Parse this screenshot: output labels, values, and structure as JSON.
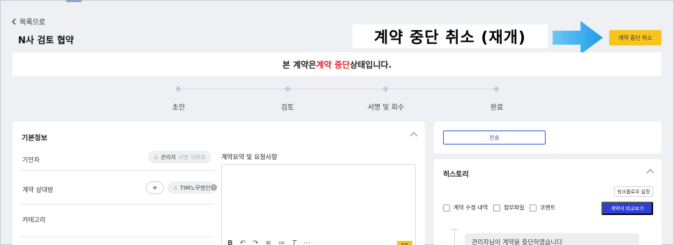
{
  "header": {
    "back_label": "목록으로",
    "title": "N사 검토 협약",
    "overlay_label": "계약 중단 취소 (재개)",
    "cancel_stop_button": "계약 중단 취소"
  },
  "banner": {
    "prefix": "본 계약은 ",
    "highlight": "계약 중단",
    "suffix": " 상태입니다."
  },
  "steps": [
    "초안",
    "검토",
    "서명 및 회수",
    "완료"
  ],
  "basic_info": {
    "title": "기본정보",
    "rows": {
      "requester_label": "기안자",
      "counterparty_label": "계약 상대방",
      "category_label": "카테고리"
    },
    "requester_pill": {
      "name": "관리자",
      "status": "서명 미완료"
    },
    "plus_label": "+",
    "counterparty_pill": "TIM노무법인",
    "remove_label": "×",
    "request_title": "계약요약 및 요청사항",
    "toolbar_symbols": [
      "B",
      "↶",
      "↷",
      "≡",
      "≔",
      "T",
      "⋯"
    ],
    "save_mini": "저장"
  },
  "send": {
    "label": "전송"
  },
  "history": {
    "title": "히스토리",
    "workflow_button": "워크플로우 설정",
    "filters": [
      "계약 수정 내역",
      "첨부파일",
      "코멘트"
    ],
    "compare_button": "계약서 비교보기",
    "message": "관리자님이 계약을 중단하였습니다"
  },
  "colors": {
    "accent_yellow": "#f7c51e",
    "accent_blue": "#2f3fd6",
    "alert_red": "#e0252d",
    "arrow_blue": "#2aa9f0"
  }
}
